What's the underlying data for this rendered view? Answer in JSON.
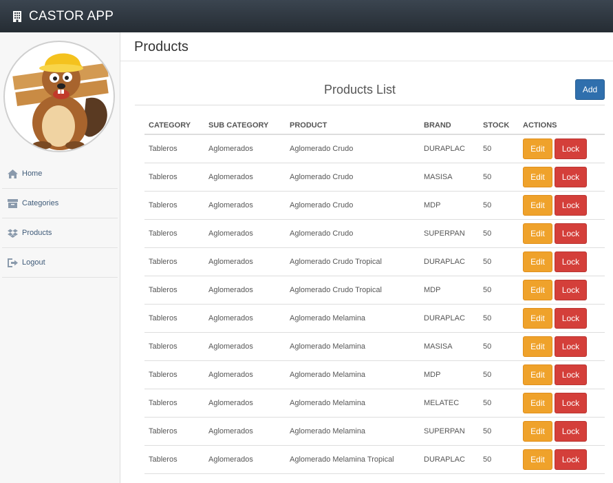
{
  "app": {
    "title": "CASTOR APP",
    "icon": "building-icon"
  },
  "sidebar": {
    "items": [
      {
        "label": "Home",
        "icon": "home-icon"
      },
      {
        "label": "Categories",
        "icon": "archive-icon"
      },
      {
        "label": "Products",
        "icon": "dropbox-icon"
      },
      {
        "label": "Logout",
        "icon": "sign-out-icon"
      }
    ]
  },
  "page": {
    "title": "Products",
    "list_title": "Products List",
    "add_label": "Add"
  },
  "table": {
    "headers": [
      "CATEGORY",
      "SUB CATEGORY",
      "PRODUCT",
      "BRAND",
      "STOCK",
      "ACTIONS"
    ],
    "edit_label": "Edit",
    "lock_label": "Lock",
    "rows": [
      [
        "Tableros",
        "Aglomerados",
        "Aglomerado Crudo",
        "DURAPLAC",
        "50"
      ],
      [
        "Tableros",
        "Aglomerados",
        "Aglomerado Crudo",
        "MASISA",
        "50"
      ],
      [
        "Tableros",
        "Aglomerados",
        "Aglomerado Crudo",
        "MDP",
        "50"
      ],
      [
        "Tableros",
        "Aglomerados",
        "Aglomerado Crudo",
        "SUPERPAN",
        "50"
      ],
      [
        "Tableros",
        "Aglomerados",
        "Aglomerado Crudo Tropical",
        "DURAPLAC",
        "50"
      ],
      [
        "Tableros",
        "Aglomerados",
        "Aglomerado Crudo Tropical",
        "MDP",
        "50"
      ],
      [
        "Tableros",
        "Aglomerados",
        "Aglomerado Melamina",
        "DURAPLAC",
        "50"
      ],
      [
        "Tableros",
        "Aglomerados",
        "Aglomerado Melamina",
        "MASISA",
        "50"
      ],
      [
        "Tableros",
        "Aglomerados",
        "Aglomerado Melamina",
        "MDP",
        "50"
      ],
      [
        "Tableros",
        "Aglomerados",
        "Aglomerado Melamina",
        "MELATEC",
        "50"
      ],
      [
        "Tableros",
        "Aglomerados",
        "Aglomerado Melamina",
        "SUPERPAN",
        "50"
      ],
      [
        "Tableros",
        "Aglomerados",
        "Aglomerado Melamina Tropical",
        "DURAPLAC",
        "50"
      ]
    ]
  },
  "colors": {
    "topbar": "#2b333b",
    "primary": "#2f6fad",
    "warning": "#efa22b",
    "danger": "#d43f3a"
  }
}
